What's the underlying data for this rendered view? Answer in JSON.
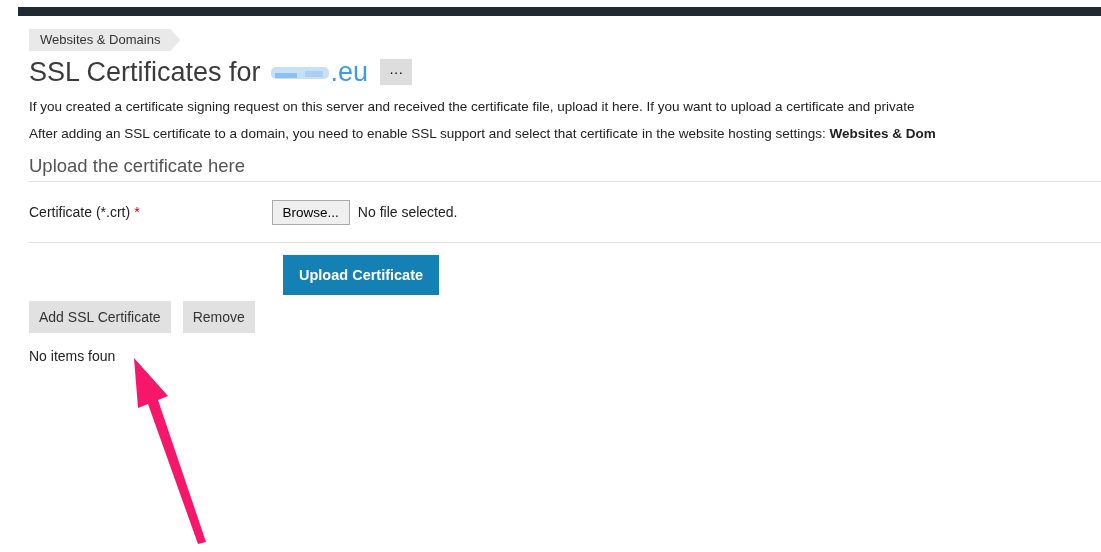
{
  "breadcrumb": "Websites & Domains",
  "title": {
    "text": "SSL Certificates for",
    "domain": ".eu",
    "more": "···"
  },
  "paragraphs": [
    "If you created a certificate signing request on this server and received the certificate file, upload it here. If you want to upload a certificate and private",
    "After adding an SSL certificate to a domain, you need to enable SSL support and select that certificate in the website hosting settings: **Websites & Dom**"
  ],
  "section": {
    "title": "Upload the certificate here",
    "field_label": "Certificate (*.crt)",
    "required_mark": "*",
    "browse": "Browse...",
    "file_status": "No file selected.",
    "submit": "Upload Certificate"
  },
  "buttons": [
    "Add SSL Certificate",
    "Remove"
  ],
  "empty_message": "No items foun"
}
